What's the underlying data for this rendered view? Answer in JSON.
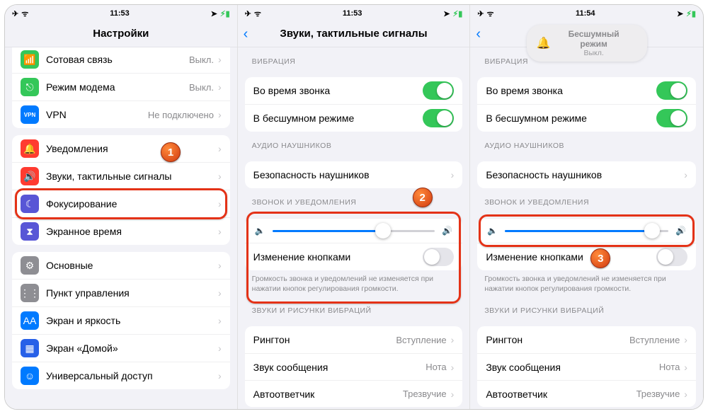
{
  "status": {
    "time1": "11:53",
    "time2": "11:53",
    "time3": "11:54"
  },
  "p1": {
    "title": "Настройки",
    "g1": [
      {
        "icon": "antenna-icon",
        "cls": "ic-green",
        "glyph": "📶",
        "label": "Сотовая связь",
        "value": "Выкл."
      },
      {
        "icon": "hotspot-icon",
        "cls": "ic-green",
        "glyph": "⎋",
        "label": "Режим модема",
        "value": "Выкл."
      },
      {
        "icon": "vpn-icon",
        "cls": "ic-blue",
        "glyph": "VPN",
        "label": "VPN",
        "value": "Не подключено"
      }
    ],
    "g2": [
      {
        "icon": "notif-icon",
        "cls": "ic-red",
        "glyph": "🔔",
        "label": "Уведомления"
      },
      {
        "icon": "sounds-icon",
        "cls": "ic-red",
        "glyph": "🔊",
        "label": "Звуки, тактильные сигналы"
      },
      {
        "icon": "focus-icon",
        "cls": "ic-indigo",
        "glyph": "☾",
        "label": "Фокусирование"
      },
      {
        "icon": "screentime-icon",
        "cls": "ic-indigo",
        "glyph": "⧗",
        "label": "Экранное время"
      }
    ],
    "g3": [
      {
        "icon": "general-icon",
        "cls": "ic-gray2",
        "glyph": "⚙",
        "label": "Основные"
      },
      {
        "icon": "control-icon",
        "cls": "ic-gray2",
        "glyph": "⋮⋮",
        "label": "Пункт управления"
      },
      {
        "icon": "display-icon",
        "cls": "ic-blue",
        "glyph": "AA",
        "label": "Экран и яркость"
      },
      {
        "icon": "home-icon",
        "cls": "ic-bluedk",
        "glyph": "▦",
        "label": "Экран «Домой»"
      },
      {
        "icon": "access-icon",
        "cls": "ic-blue",
        "glyph": "☺",
        "label": "Универсальный доступ"
      }
    ]
  },
  "p2": {
    "title": "Звуки, тактильные сигналы",
    "sec1": "ВИБРАЦИЯ",
    "r1": "Во время звонка",
    "r2": "В бесшумном режиме",
    "sec2": "АУДИО НАУШНИКОВ",
    "r3": "Безопасность наушников",
    "sec3": "ЗВОНОК И УВЕДОМЛЕНИЯ",
    "r4": "Изменение кнопками",
    "note": "Громкость звонка и уведомлений не изменяется при нажатии кнопок регулирования громкости.",
    "sec4": "ЗВУКИ И РИСУНКИ ВИБРАЦИЙ",
    "rows4": [
      {
        "label": "Рингтон",
        "value": "Вступление"
      },
      {
        "label": "Звук сообщения",
        "value": "Нота"
      },
      {
        "label": "Автоответчик",
        "value": "Трезвучие"
      }
    ],
    "sliderFill2": "68%",
    "sliderFill3": "90%"
  },
  "pill": {
    "title": "Бесшумный режим",
    "sub": "Выкл."
  },
  "badges": {
    "b1": "1",
    "b2": "2",
    "b3": "3"
  }
}
